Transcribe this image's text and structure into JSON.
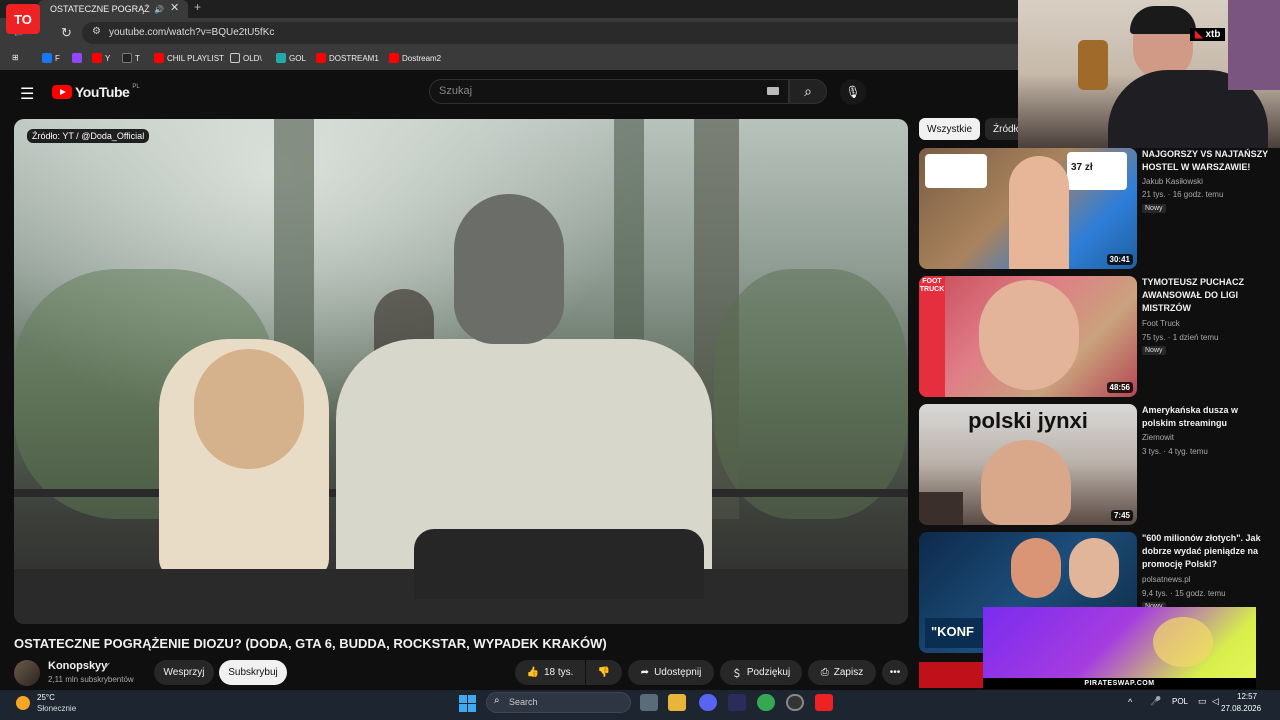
{
  "browser": {
    "tab_title": "OSTATECZNE POGRĄŻENIE",
    "tab_close": "✕",
    "new_tab": "+",
    "url": "youtube.com/watch?v=BQUe2tU5fKc",
    "bookmarks": [
      {
        "label": "F",
        "color": "#1877f2"
      },
      {
        "label": "",
        "color": "#9146ff"
      },
      {
        "label": "Y",
        "color": "#ff0000"
      },
      {
        "label": "T",
        "color": "#222222"
      },
      {
        "label": "CHIL PLAYLIST",
        "color": "#ff0000"
      },
      {
        "label": "OLD\\",
        "color": "#666666"
      },
      {
        "label": "GOL",
        "color": "#2aa"
      },
      {
        "label": "DOSTREAM1",
        "color": "#ff0000"
      },
      {
        "label": "Dostream2",
        "color": "#ff0000"
      }
    ]
  },
  "overlay": {
    "logo_text": "TO"
  },
  "youtube": {
    "logo_text": "YouTube",
    "logo_region": "PL",
    "search_placeholder": "Szukaj",
    "search_icon": "⌕",
    "mic_icon": "🎙"
  },
  "video": {
    "source_badge": "Źródło: YT / @Doda_Official",
    "title": "OSTATECZNE POGRĄŻENIE DIOZU? (DODA, GTA 6, BUDDA, ROCKSTAR, WYPADEK KRAKÓW)",
    "channel": "Konopskyy",
    "verified_icon": "✔",
    "subscribers": "2,11 mln subskrybentów",
    "support_label": "Wesprzyj",
    "subscribe_label": "Subskrybuj",
    "likes": "18 tys.",
    "share_label": "Udostępnij",
    "thanks_label": "Podziękuj",
    "save_label": "Zapisz",
    "more_label": "•••"
  },
  "chips": {
    "all": "Wszystkie",
    "source": "Źródło"
  },
  "recommendations": [
    {
      "title": "NAJGORSZY VS NAJTAŃSZY HOSTEL W WARSZAWIE!",
      "channel": "Jakub Kasiłowski",
      "views": "21 tys.",
      "age": "16 godz. temu",
      "badge": "Nowy",
      "duration": "30:41",
      "thumb_text": "37 zł"
    },
    {
      "title": "TYMOTEUSZ PUCHACZ AWANSOWAŁ DO LIGI MISTRZÓW",
      "channel": "Foot Truck",
      "views": "75 tys.",
      "age": "1 dzień temu",
      "badge": "Nowy",
      "duration": "48:56",
      "thumb_text": "FOOT TRUCK"
    },
    {
      "title": "Amerykańska dusza w polskim streamingu",
      "channel": "Ziemowit",
      "views": "3 tys.",
      "age": "4 tyg. temu",
      "badge": "",
      "duration": "7:45",
      "thumb_text": "polski jynxi"
    },
    {
      "title": "\"600 milionów złotych\". Jak dobrze wydać pieniądze na promocję Polski?",
      "channel": "polsatnews.pl",
      "views": "9,4 tys.",
      "age": "15 godz. temu",
      "badge": "Nowy",
      "duration": "",
      "thumb_text": "\"KONF"
    }
  ],
  "webcam": {
    "sponsor": "xtb"
  },
  "ad": {
    "text": "PIRATESWAP.COM"
  },
  "taskbar": {
    "temperature": "25°C",
    "weather": "Słonecznie",
    "search_placeholder": "Search",
    "language": "POL",
    "time": "12:57",
    "date": "27.08.2026"
  }
}
